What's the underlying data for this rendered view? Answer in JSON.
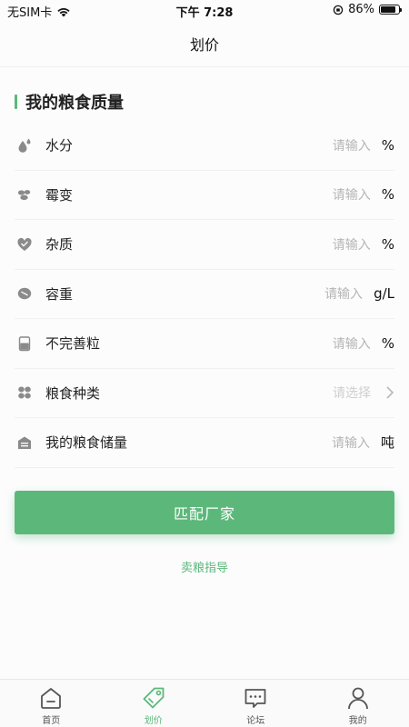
{
  "status_bar": {
    "carrier": "无SIM卡",
    "time": "下午 7:28",
    "battery_percent": "86%",
    "battery_level": 0.86
  },
  "nav": {
    "title": "划价"
  },
  "section": {
    "title": "我的粮食质量"
  },
  "form": {
    "rows": [
      {
        "label": "水分",
        "placeholder": "请输入",
        "unit": "%",
        "icon": "water-drop-icon"
      },
      {
        "label": "霉变",
        "placeholder": "请输入",
        "unit": "%",
        "icon": "mold-icon"
      },
      {
        "label": "杂质",
        "placeholder": "请输入",
        "unit": "%",
        "icon": "impurity-icon"
      },
      {
        "label": "容重",
        "placeholder": "请输入",
        "unit": "g/L",
        "icon": "bulk-density-icon"
      },
      {
        "label": "不完善粒",
        "placeholder": "请输入",
        "unit": "%",
        "icon": "imperfect-grain-icon"
      },
      {
        "label": "粮食种类",
        "placeholder": "请选择",
        "unit": "",
        "icon": "grain-type-icon"
      },
      {
        "label": "我的粮食储量",
        "placeholder": "请输入",
        "unit": "吨",
        "icon": "storage-icon"
      }
    ]
  },
  "actions": {
    "match_label": "匹配厂家",
    "guide_label": "卖粮指导"
  },
  "tabs": [
    {
      "label": "首页",
      "icon": "home-icon",
      "active": false
    },
    {
      "label": "划价",
      "icon": "price-tag-icon",
      "active": true
    },
    {
      "label": "论坛",
      "icon": "forum-icon",
      "active": false
    },
    {
      "label": "我的",
      "icon": "profile-icon",
      "active": false
    }
  ],
  "colors": {
    "accent": "#5cb87a",
    "icon_gray": "#8a8a8a",
    "placeholder": "#b5b5b5"
  }
}
